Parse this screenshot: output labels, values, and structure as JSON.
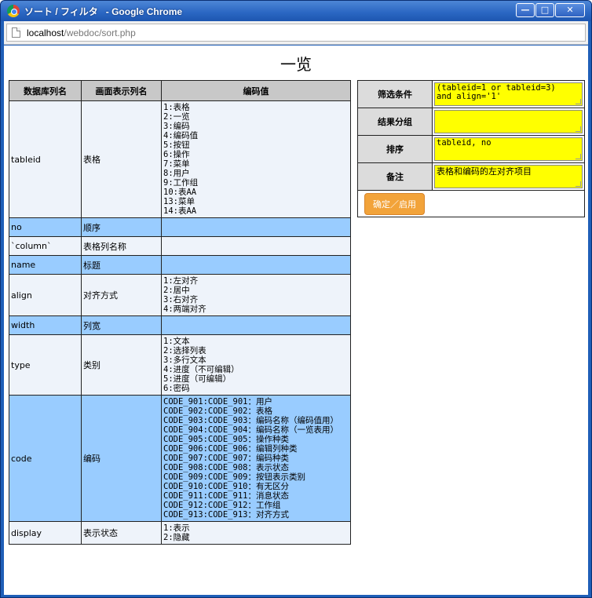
{
  "window": {
    "title": "ソート / フィルタ   - Google Chrome",
    "controls": {
      "minimize": "—",
      "maximize": "□",
      "close": "✕"
    }
  },
  "address": {
    "host": "localhost",
    "path": "/webdoc/sort.php"
  },
  "page": {
    "title": "一览"
  },
  "list": {
    "headers": [
      "数据库列名",
      "画面表示列名",
      "编码值"
    ],
    "rows": [
      {
        "db": "tableid",
        "display": "表格",
        "values": "1:表格\n2:一览\n3:编码\n4:编码值\n5:按钮\n6:操作\n7:菜单\n8:用户\n9:工作组\n10:表AA\n13:菜单\n14:表AA"
      },
      {
        "db": "no",
        "display": "顺序",
        "values": ""
      },
      {
        "db": "`column`",
        "display": "表格列名称",
        "values": ""
      },
      {
        "db": "name",
        "display": "标题",
        "values": ""
      },
      {
        "db": "align",
        "display": "对齐方式",
        "values": "1:左对齐\n2:居中\n3:右对齐\n4:两端对齐"
      },
      {
        "db": "width",
        "display": "列宽",
        "values": ""
      },
      {
        "db": "type",
        "display": "类别",
        "values": "1:文本\n2:选择列表\n3:多行文本\n4:进度（不可编辑）\n5:进度（可编辑）\n6:密码"
      },
      {
        "db": "code",
        "display": "编码",
        "values": "CODE_901:CODE_901：用户\nCODE_902:CODE_902：表格\nCODE_903:CODE_903：编码名称（编码值用）\nCODE_904:CODE_904：编码名称（一览表用）\nCODE_905:CODE_905：操作种类\nCODE_906:CODE_906：编辑列种类\nCODE_907:CODE_907：编码种类\nCODE_908:CODE_908：表示状态\nCODE_909:CODE_909：按钮表示类别\nCODE_910:CODE_910：有无区分\nCODE_911:CODE_911：消息状态\nCODE_912:CODE_912：工作组\nCODE_913:CODE_913：对齐方式"
      },
      {
        "db": "display",
        "display": "表示状态",
        "values": "1:表示\n2:隐藏"
      }
    ]
  },
  "filter": {
    "condition_label": "筛选条件",
    "condition_value": "(tableid=1 or tableid=3)\nand align='1'",
    "group_label": "结果分组",
    "group_value": "",
    "sort_label": "排序",
    "sort_value": "tableid, no",
    "note_label": "备注",
    "note_value": "表格和编码的左对齐项目",
    "submit_label": "确定／启用"
  },
  "colors": {
    "header_bg": "#c8c8c8",
    "row_blue": "#99ccff",
    "row_light": "#eef3fa",
    "field_yellow": "#ffff00",
    "button_orange": "#f2a33a",
    "titlebar_blue": "#2a66c2"
  }
}
